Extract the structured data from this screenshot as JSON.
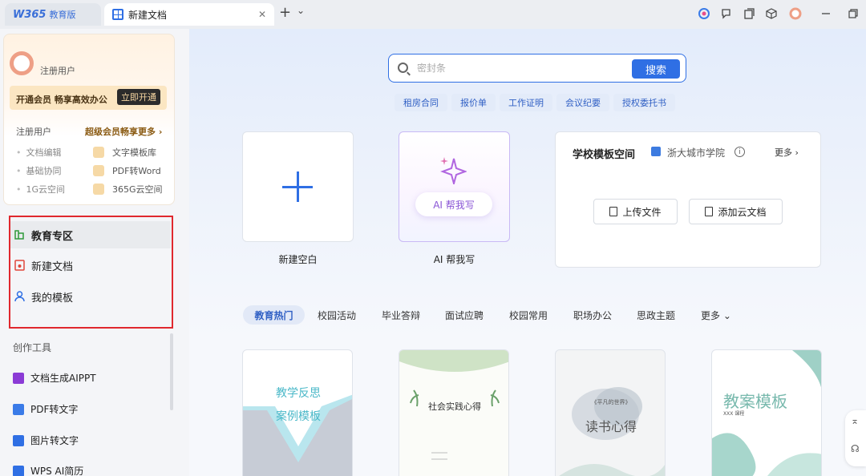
{
  "tabs": {
    "home_logo": "W365",
    "home_label": "教育版",
    "doc_label": "新建文档",
    "close_glyph": "✕",
    "add_glyph": "+",
    "dropdown_glyph": "⌄"
  },
  "sidebar": {
    "username": "注册用户",
    "vip_banner": "开通会员 畅享高效办公",
    "vip_button": "立即开通",
    "compare_left_title": "注册用户",
    "compare_right_title": "超级会员畅享更多 ›",
    "compare_left": [
      "文档编辑",
      "基础协同",
      "1G云空间"
    ],
    "compare_right": [
      "文字模板库",
      "PDF转Word",
      "365G云空间"
    ],
    "nav": [
      {
        "label": "教育专区",
        "icon": "education-icon"
      },
      {
        "label": "新建文档",
        "icon": "new-doc-icon"
      },
      {
        "label": "我的模板",
        "icon": "user-icon"
      }
    ],
    "tools_title": "创作工具",
    "tools": [
      {
        "label": "文档生成AIPPT",
        "color": "#8b3bd6"
      },
      {
        "label": "PDF转文字",
        "color": "#3a7be8"
      },
      {
        "label": "图片转文字",
        "color": "#2f6fe4"
      },
      {
        "label": "WPS AI简历",
        "color": "#2f6fe4"
      }
    ]
  },
  "search": {
    "placeholder": "密封条",
    "button": "搜索",
    "chips": [
      "租房合同",
      "报价单",
      "工作证明",
      "会议纪要",
      "授权委托书"
    ]
  },
  "cards": {
    "blank_caption": "新建空白",
    "ai_pill": "AI 帮我写",
    "ai_caption": "AI 帮我写"
  },
  "school": {
    "title": "学校模板空间",
    "name": "浙大城市学院",
    "info": "i",
    "more": "更多 ›",
    "upload": "上传文件",
    "add_cloud": "添加云文档"
  },
  "categories": [
    "教育热门",
    "校园活动",
    "毕业答辩",
    "面试应聘",
    "校园常用",
    "职场办公",
    "思政主题",
    "更多 ⌄"
  ],
  "templates": [
    {
      "line1": "教学反思",
      "line2": "案例模板"
    },
    {
      "title": "社会实践心得"
    },
    {
      "subtitle": "《平凡的世界》",
      "title": "读书心得"
    },
    {
      "title": "教案模板",
      "sub": "XXX 课程"
    }
  ],
  "colors": {
    "accent": "#2f6fe4",
    "alert_box": "#e0282e",
    "vip_gold": "#fbe6c2"
  }
}
